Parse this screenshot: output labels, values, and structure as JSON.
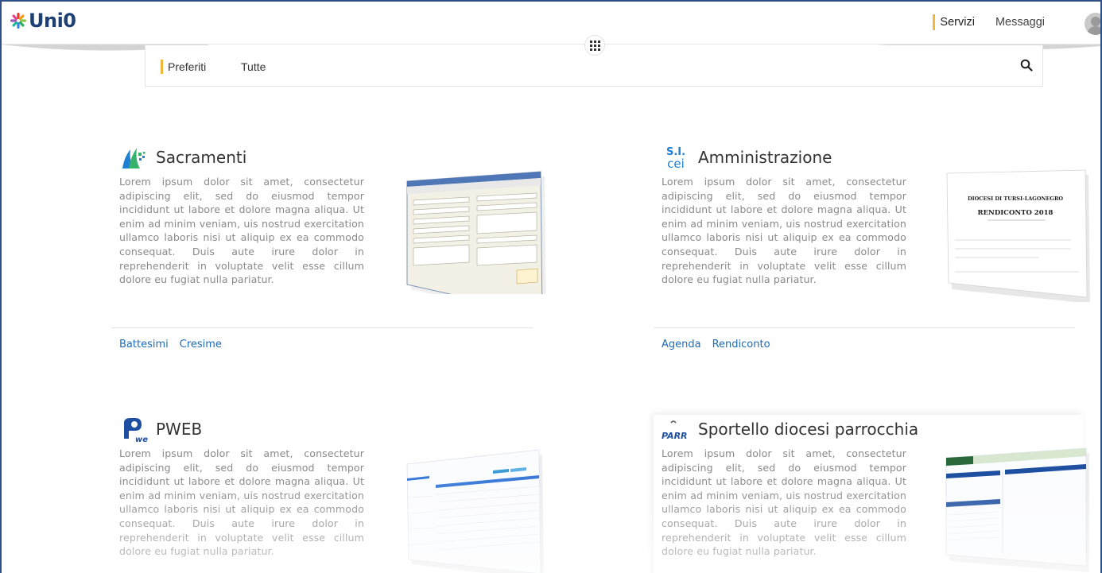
{
  "brand": {
    "name": "Uni0"
  },
  "topnav": {
    "items": [
      {
        "label": "Servizi",
        "active": true
      },
      {
        "label": "Messaggi",
        "active": false
      }
    ]
  },
  "filter": {
    "tabs": [
      {
        "label": "Preferiti",
        "active": true
      },
      {
        "label": "Tutte",
        "active": false
      }
    ]
  },
  "colors": {
    "accent": "#f0b73a",
    "brand": "#1e3f74",
    "link": "#1e6bb8",
    "frame": "#2f4f87"
  },
  "cards": [
    {
      "title": "Sacramenti",
      "logo": "sacramenti-logo-icon",
      "description": "Lorem ipsum dolor sit amet, consectetur adipiscing elit, sed do eiusmod tempor incididunt ut labore et dolore magna aliqua. Ut enim ad minim veniam, uis nostrud exercitation ullamco laboris nisi ut aliquip ex ea commodo consequat. Duis aute irure dolor in reprehenderit in voluptate velit esse cillum dolore eu fugiat nulla pariatur.",
      "links": [
        "Battesimi",
        "Cresime"
      ]
    },
    {
      "title": "Amministrazione",
      "logo": "sicei-logo-icon",
      "logo_text": [
        "S.I.",
        "cei"
      ],
      "description": "Lorem ipsum dolor sit amet, consectetur adipiscing elit, sed do eiusmod tempor incididunt ut labore et dolore magna aliqua. Ut enim ad minim veniam, uis nostrud exercitation ullamco laboris nisi ut aliquip ex ea commodo consequat. Duis aute irure dolor in reprehenderit in voluptate velit esse cillum dolore eu fugiat nulla pariatur.",
      "links": [
        "Agenda",
        "Rendiconto"
      ],
      "thumb_text": {
        "heading": "DIOCESI DI TURSI-LAGONEGRO",
        "subheading": "RENDICONTO 2018"
      }
    },
    {
      "title": "PWEB",
      "logo": "pweb-logo-icon",
      "logo_text": "web",
      "description": "Lorem ipsum dolor sit amet, consectetur adipiscing elit, sed do eiusmod tempor incididunt ut labore et dolore magna aliqua. Ut enim ad minim veniam, uis nostrud exercitation ullamco laboris nisi ut aliquip ex ea commodo consequat. Duis aute irure dolor in reprehenderit in voluptate velit esse cillum dolore eu fugiat nulla pariatur.",
      "links": []
    },
    {
      "title": "Sportello diocesi parrocchia",
      "logo": "parr-logo-icon",
      "logo_text": "PARR",
      "description": "Lorem ipsum dolor sit amet, consectetur adipiscing elit, sed do eiusmod tempor incididunt ut labore et dolore magna aliqua. Ut enim ad minim veniam, uis nostrud exercitation ullamco laboris nisi ut aliquip ex ea commodo consequat. Duis aute irure dolor in reprehenderit in voluptate velit esse cillum dolore eu fugiat nulla pariatur.",
      "links": []
    }
  ]
}
